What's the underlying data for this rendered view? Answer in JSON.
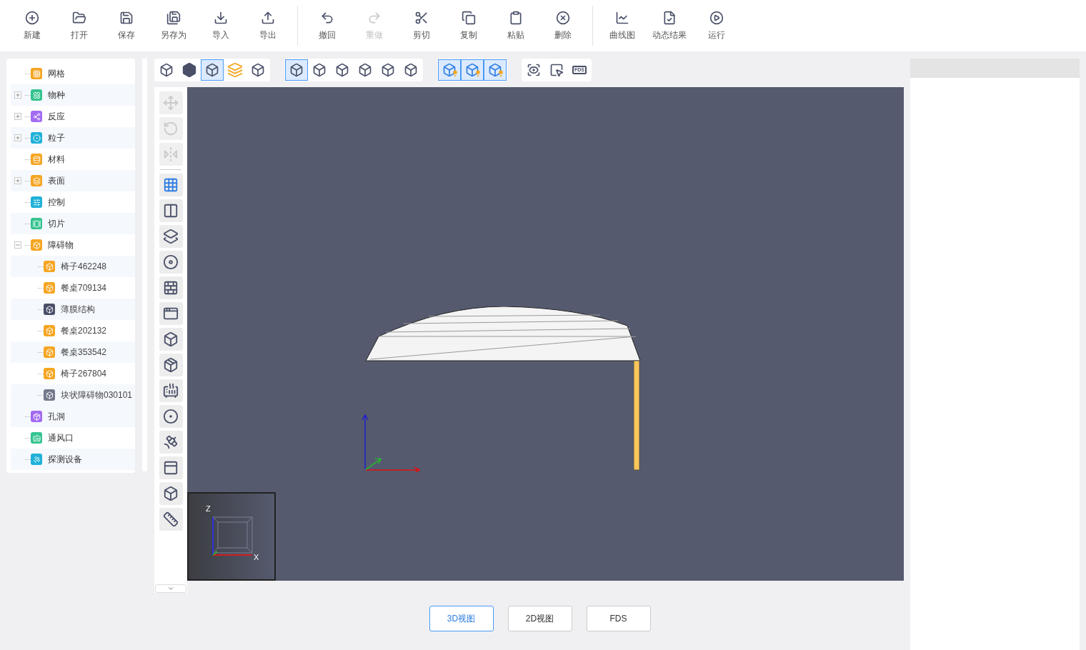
{
  "toolbar": {
    "groups": [
      [
        {
          "kind": "new",
          "label": "新建",
          "disabled": false
        },
        {
          "kind": "open",
          "label": "打开",
          "disabled": false
        },
        {
          "kind": "save",
          "label": "保存",
          "disabled": false
        },
        {
          "kind": "saveas",
          "label": "另存为",
          "disabled": false
        },
        {
          "kind": "import",
          "label": "导入",
          "disabled": false
        },
        {
          "kind": "export",
          "label": "导出",
          "disabled": false
        }
      ],
      [
        {
          "kind": "undo",
          "label": "撤回",
          "disabled": false
        },
        {
          "kind": "redo",
          "label": "重做",
          "disabled": true
        },
        {
          "kind": "cut",
          "label": "剪切",
          "disabled": false
        },
        {
          "kind": "copy",
          "label": "复制",
          "disabled": false
        },
        {
          "kind": "paste",
          "label": "粘贴",
          "disabled": false
        },
        {
          "kind": "delete",
          "label": "删除",
          "disabled": false
        }
      ],
      [
        {
          "kind": "chart",
          "label": "曲线图",
          "disabled": false
        },
        {
          "kind": "results",
          "label": "动态结果",
          "disabled": false
        },
        {
          "kind": "run",
          "label": "运行",
          "disabled": false
        }
      ]
    ]
  },
  "tree": [
    {
      "kind": "grid",
      "label": "网格",
      "color": "#f5a623",
      "expandable": false,
      "expanded": false
    },
    {
      "kind": "species",
      "label": "物种",
      "color": "#34c38f",
      "expandable": true,
      "expanded": false
    },
    {
      "kind": "reaction",
      "label": "反应",
      "color": "#a36bf0",
      "expandable": true,
      "expanded": false
    },
    {
      "kind": "particle",
      "label": "粒子",
      "color": "#1fb1d8",
      "expandable": true,
      "expanded": false
    },
    {
      "kind": "material",
      "label": "材料",
      "color": "#f5a623",
      "expandable": false,
      "expanded": false
    },
    {
      "kind": "surface",
      "label": "表面",
      "color": "#f5a623",
      "expandable": true,
      "expanded": false
    },
    {
      "kind": "control",
      "label": "控制",
      "color": "#1fb1d8",
      "expandable": false,
      "expanded": false
    },
    {
      "kind": "slice",
      "label": "切片",
      "color": "#34c38f",
      "expandable": false,
      "expanded": false
    },
    {
      "kind": "obstruction",
      "label": "障碍物",
      "color": "#f5a623",
      "expandable": true,
      "expanded": true,
      "children": [
        {
          "label": "椅子462248",
          "color": "#f5a623"
        },
        {
          "label": "餐桌709134",
          "color": "#f5a623"
        },
        {
          "label": "薄膜结构",
          "color": "#4a5068"
        },
        {
          "label": "餐桌202132",
          "color": "#f5a623"
        },
        {
          "label": "餐桌353542",
          "color": "#f5a623"
        },
        {
          "label": "椅子267804",
          "color": "#f5a623"
        },
        {
          "label": "块状障碍物030101",
          "color": "#737a8c"
        }
      ]
    },
    {
      "kind": "hole",
      "label": "孔洞",
      "color": "#a36bf0",
      "expandable": false,
      "expanded": false
    },
    {
      "kind": "vent",
      "label": "通风口",
      "color": "#34c38f",
      "expandable": false,
      "expanded": false
    },
    {
      "kind": "device",
      "label": "探测设备",
      "color": "#1fb1d8",
      "expandable": false,
      "expanded": false
    }
  ],
  "view_toolbar": [
    [
      {
        "kind": "wire",
        "selected": false
      },
      {
        "kind": "solid",
        "selected": false
      },
      {
        "kind": "shaded",
        "selected": true
      },
      {
        "kind": "layers",
        "selected": false
      },
      {
        "kind": "section",
        "selected": false
      }
    ],
    [
      {
        "kind": "top",
        "selected": true
      },
      {
        "kind": "bottom",
        "selected": false
      },
      {
        "kind": "front",
        "selected": false
      },
      {
        "kind": "back",
        "selected": false
      },
      {
        "kind": "left",
        "selected": false
      },
      {
        "kind": "right",
        "selected": false
      }
    ],
    [
      {
        "kind": "light-grid",
        "selected": true
      },
      {
        "kind": "light-wire",
        "selected": true
      },
      {
        "kind": "light-solid",
        "selected": true
      }
    ],
    [
      {
        "kind": "eye",
        "selected": false
      },
      {
        "kind": "pointer",
        "selected": false
      },
      {
        "kind": "fds",
        "selected": false,
        "label": "FDS"
      }
    ]
  ],
  "side_tools": [
    {
      "kind": "move",
      "disabled": true,
      "selected": false
    },
    {
      "kind": "rotate",
      "disabled": true,
      "selected": false
    },
    {
      "kind": "mirror",
      "disabled": true,
      "selected": false
    },
    {
      "kind": "grid",
      "disabled": false,
      "selected": true
    },
    {
      "kind": "split",
      "disabled": false,
      "selected": false
    },
    {
      "kind": "plane",
      "disabled": false,
      "selected": false
    },
    {
      "kind": "plane-holes",
      "disabled": false,
      "selected": false
    },
    {
      "kind": "wall",
      "disabled": false,
      "selected": false
    },
    {
      "kind": "wall-window",
      "disabled": false,
      "selected": false
    },
    {
      "kind": "cube",
      "disabled": false,
      "selected": false
    },
    {
      "kind": "cube-hole",
      "disabled": false,
      "selected": false
    },
    {
      "kind": "vent",
      "disabled": false,
      "selected": false
    },
    {
      "kind": "particles",
      "disabled": false,
      "selected": false
    },
    {
      "kind": "device",
      "disabled": false,
      "selected": false
    },
    {
      "kind": "slice",
      "disabled": false,
      "selected": false
    },
    {
      "kind": "column",
      "disabled": false,
      "selected": false
    },
    {
      "kind": "ruler",
      "disabled": false,
      "selected": false
    }
  ],
  "minimap": {
    "z_label": "Z",
    "x_label": "X"
  },
  "view_tabs": [
    {
      "label": "3D视图",
      "selected": true
    },
    {
      "label": "2D视图",
      "selected": false
    },
    {
      "label": "FDS",
      "selected": false
    }
  ]
}
